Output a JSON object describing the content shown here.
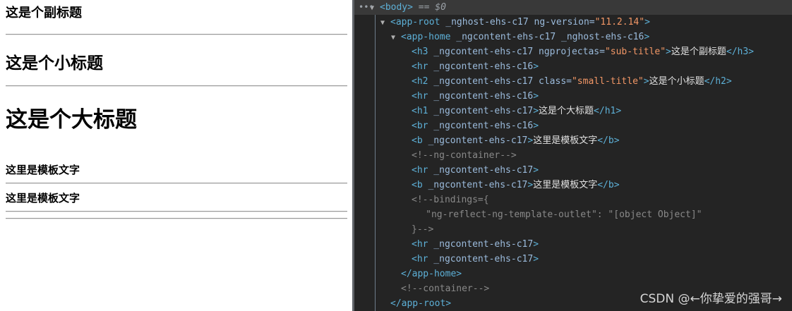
{
  "page": {
    "sub_title": "这是个副标题",
    "small_title": "这是个小标题",
    "big_title": "这是个大标题",
    "template_text_1": "这里是模板文字",
    "template_text_2": "这里是模板文字"
  },
  "devtools": {
    "dots": "•••",
    "lines": [
      {
        "arrow": "▼",
        "parts": [
          [
            "tag",
            "<body>"
          ],
          [
            "eq",
            " == $0"
          ]
        ]
      },
      {
        "arrow": "▼",
        "parts": [
          [
            "tag",
            "<app-root"
          ],
          [
            "attr",
            " _nghost-ehs-c17 ng-version="
          ],
          [
            "val",
            "\"11.2.14\""
          ],
          [
            "tag",
            ">"
          ]
        ]
      },
      {
        "arrow": "▼",
        "parts": [
          [
            "tag",
            "<app-home"
          ],
          [
            "attr",
            " _ngcontent-ehs-c17 _nghost-ehs-c16"
          ],
          [
            "tag",
            ">"
          ]
        ]
      },
      {
        "arrow": "",
        "parts": [
          [
            "tag",
            "<h3"
          ],
          [
            "attr",
            " _ngcontent-ehs-c17 ngprojectas="
          ],
          [
            "val",
            "\"sub-title\""
          ],
          [
            "tag",
            ">"
          ],
          [
            "txt",
            "这是个副标题"
          ],
          [
            "tag",
            "</h3>"
          ]
        ]
      },
      {
        "arrow": "",
        "parts": [
          [
            "tag",
            "<hr"
          ],
          [
            "attr",
            " _ngcontent-ehs-c16"
          ],
          [
            "tag",
            ">"
          ]
        ]
      },
      {
        "arrow": "",
        "parts": [
          [
            "tag",
            "<h2"
          ],
          [
            "attr",
            " _ngcontent-ehs-c17 class="
          ],
          [
            "val",
            "\"small-title\""
          ],
          [
            "tag",
            ">"
          ],
          [
            "txt",
            "这是个小标题"
          ],
          [
            "tag",
            "</h2>"
          ]
        ]
      },
      {
        "arrow": "",
        "parts": [
          [
            "tag",
            "<hr"
          ],
          [
            "attr",
            " _ngcontent-ehs-c16"
          ],
          [
            "tag",
            ">"
          ]
        ]
      },
      {
        "arrow": "",
        "parts": [
          [
            "tag",
            "<h1"
          ],
          [
            "attr",
            " _ngcontent-ehs-c17"
          ],
          [
            "tag",
            ">"
          ],
          [
            "txt",
            "这是个大标题"
          ],
          [
            "tag",
            "</h1>"
          ]
        ]
      },
      {
        "arrow": "",
        "parts": [
          [
            "tag",
            "<br"
          ],
          [
            "attr",
            " _ngcontent-ehs-c16"
          ],
          [
            "tag",
            ">"
          ]
        ]
      },
      {
        "arrow": "",
        "parts": [
          [
            "tag",
            "<b"
          ],
          [
            "attr",
            " _ngcontent-ehs-c17"
          ],
          [
            "tag",
            ">"
          ],
          [
            "txt",
            "这里是模板文字"
          ],
          [
            "tag",
            "</b>"
          ]
        ]
      },
      {
        "arrow": "",
        "parts": [
          [
            "cmt",
            "<!--ng-container-->"
          ]
        ]
      },
      {
        "arrow": "",
        "parts": [
          [
            "tag",
            "<hr"
          ],
          [
            "attr",
            " _ngcontent-ehs-c17"
          ],
          [
            "tag",
            ">"
          ]
        ]
      },
      {
        "arrow": "",
        "parts": [
          [
            "tag",
            "<b"
          ],
          [
            "attr",
            " _ngcontent-ehs-c17"
          ],
          [
            "tag",
            ">"
          ],
          [
            "txt",
            "这里是模板文字"
          ],
          [
            "tag",
            "</b>"
          ]
        ]
      },
      {
        "arrow": "",
        "parts": [
          [
            "cmt",
            "<!--bindings={"
          ]
        ]
      },
      {
        "arrow": "",
        "parts": [
          [
            "cmt",
            "  \"ng-reflect-ng-template-outlet\": \"[object Object]\""
          ]
        ]
      },
      {
        "arrow": "",
        "parts": [
          [
            "cmt",
            "}-->"
          ]
        ]
      },
      {
        "arrow": "",
        "parts": [
          [
            "tag",
            "<hr"
          ],
          [
            "attr",
            " _ngcontent-ehs-c17"
          ],
          [
            "tag",
            ">"
          ]
        ]
      },
      {
        "arrow": "",
        "parts": [
          [
            "tag",
            "<hr"
          ],
          [
            "attr",
            " _ngcontent-ehs-c17"
          ],
          [
            "tag",
            ">"
          ]
        ]
      },
      {
        "arrow": "",
        "parts": [
          [
            "tag",
            "</app-home>"
          ]
        ]
      },
      {
        "arrow": "",
        "parts": [
          [
            "cmt",
            "<!--container-->"
          ]
        ]
      },
      {
        "arrow": "",
        "parts": [
          [
            "tag",
            "</app-root>"
          ]
        ]
      }
    ]
  },
  "watermark": "CSDN @←你挚爱的强哥→"
}
